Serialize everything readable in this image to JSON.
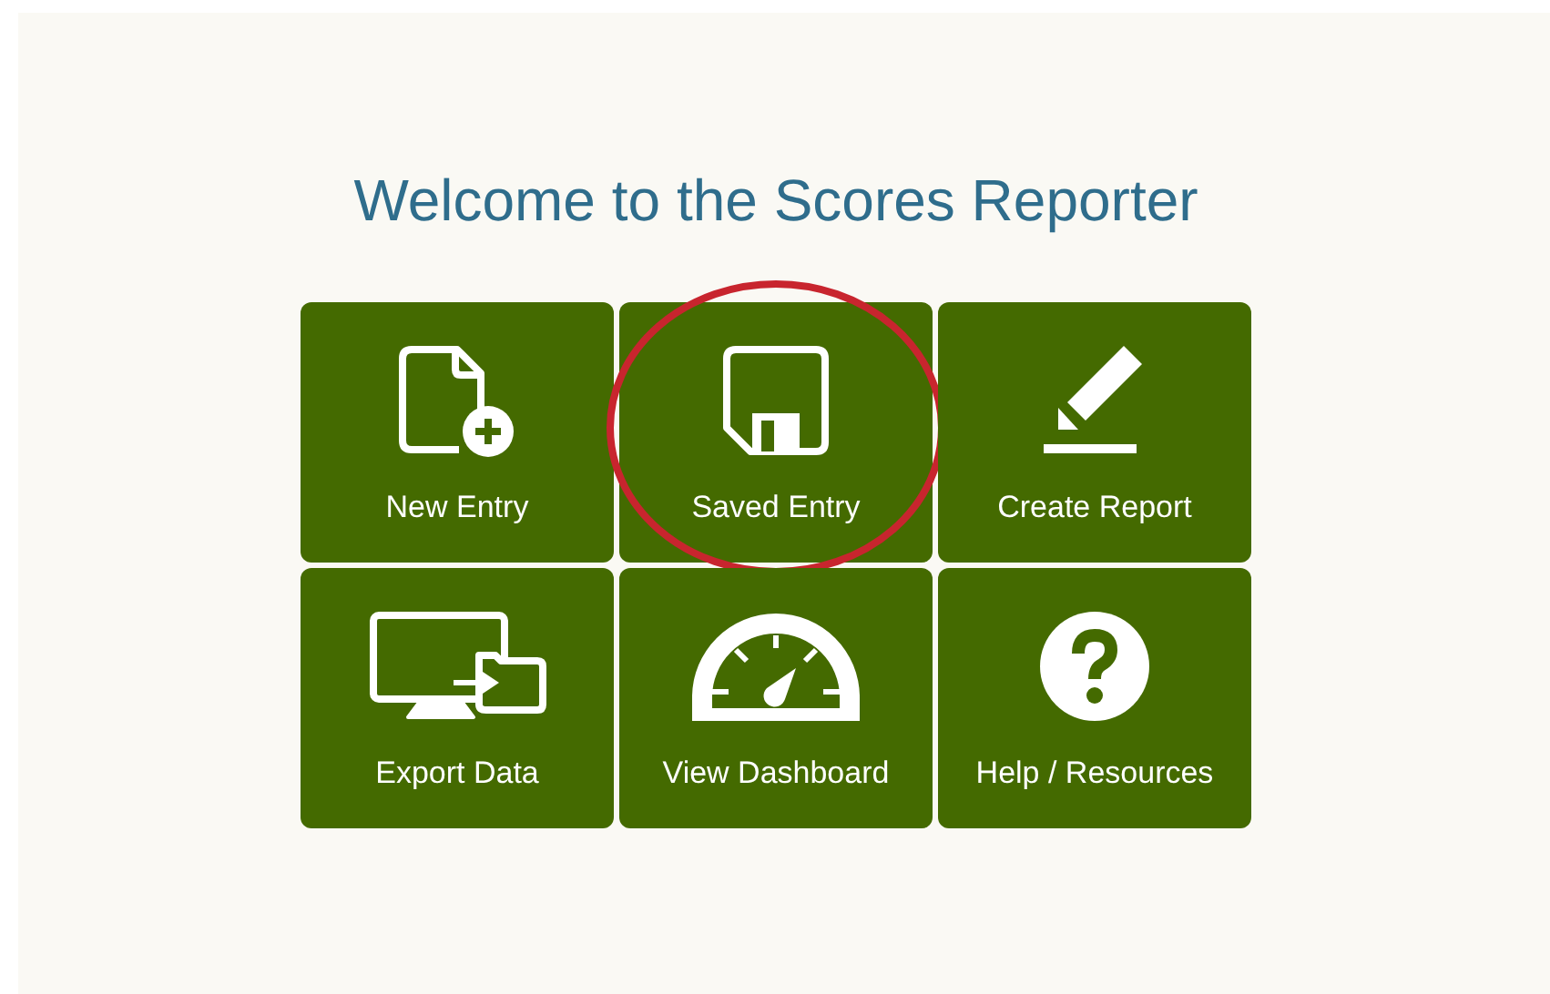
{
  "title": "Welcome to the Scores Reporter",
  "tiles": [
    {
      "label": "New Entry",
      "circled": false
    },
    {
      "label": "Saved Entry",
      "circled": true
    },
    {
      "label": "Create Report",
      "circled": false
    },
    {
      "label": "Export Data",
      "circled": false
    },
    {
      "label": "View Dashboard",
      "circled": false
    },
    {
      "label": "Help / Resources",
      "circled": false
    }
  ]
}
